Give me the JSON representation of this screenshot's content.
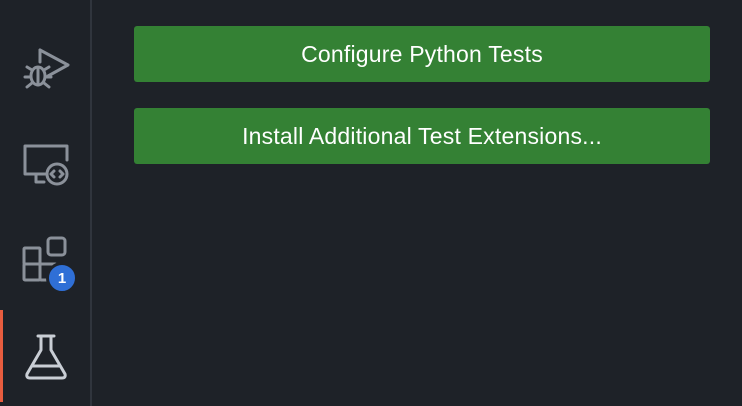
{
  "activity_bar": {
    "items": [
      {
        "name": "run-and-debug",
        "icon": "run-debug-icon"
      },
      {
        "name": "remote-explorer",
        "icon": "remote-explorer-icon"
      },
      {
        "name": "extensions",
        "icon": "extensions-icon",
        "badge": "1"
      },
      {
        "name": "testing",
        "icon": "beaker-icon",
        "active": true
      }
    ]
  },
  "testing_panel": {
    "configure_label": "Configure Python Tests",
    "install_label": "Install Additional Test Extensions..."
  },
  "colors": {
    "background": "#1e2228",
    "button": "#348134",
    "active_indicator": "#e85d3f",
    "badge": "#2f6fd6",
    "icon": "#8b919a"
  }
}
